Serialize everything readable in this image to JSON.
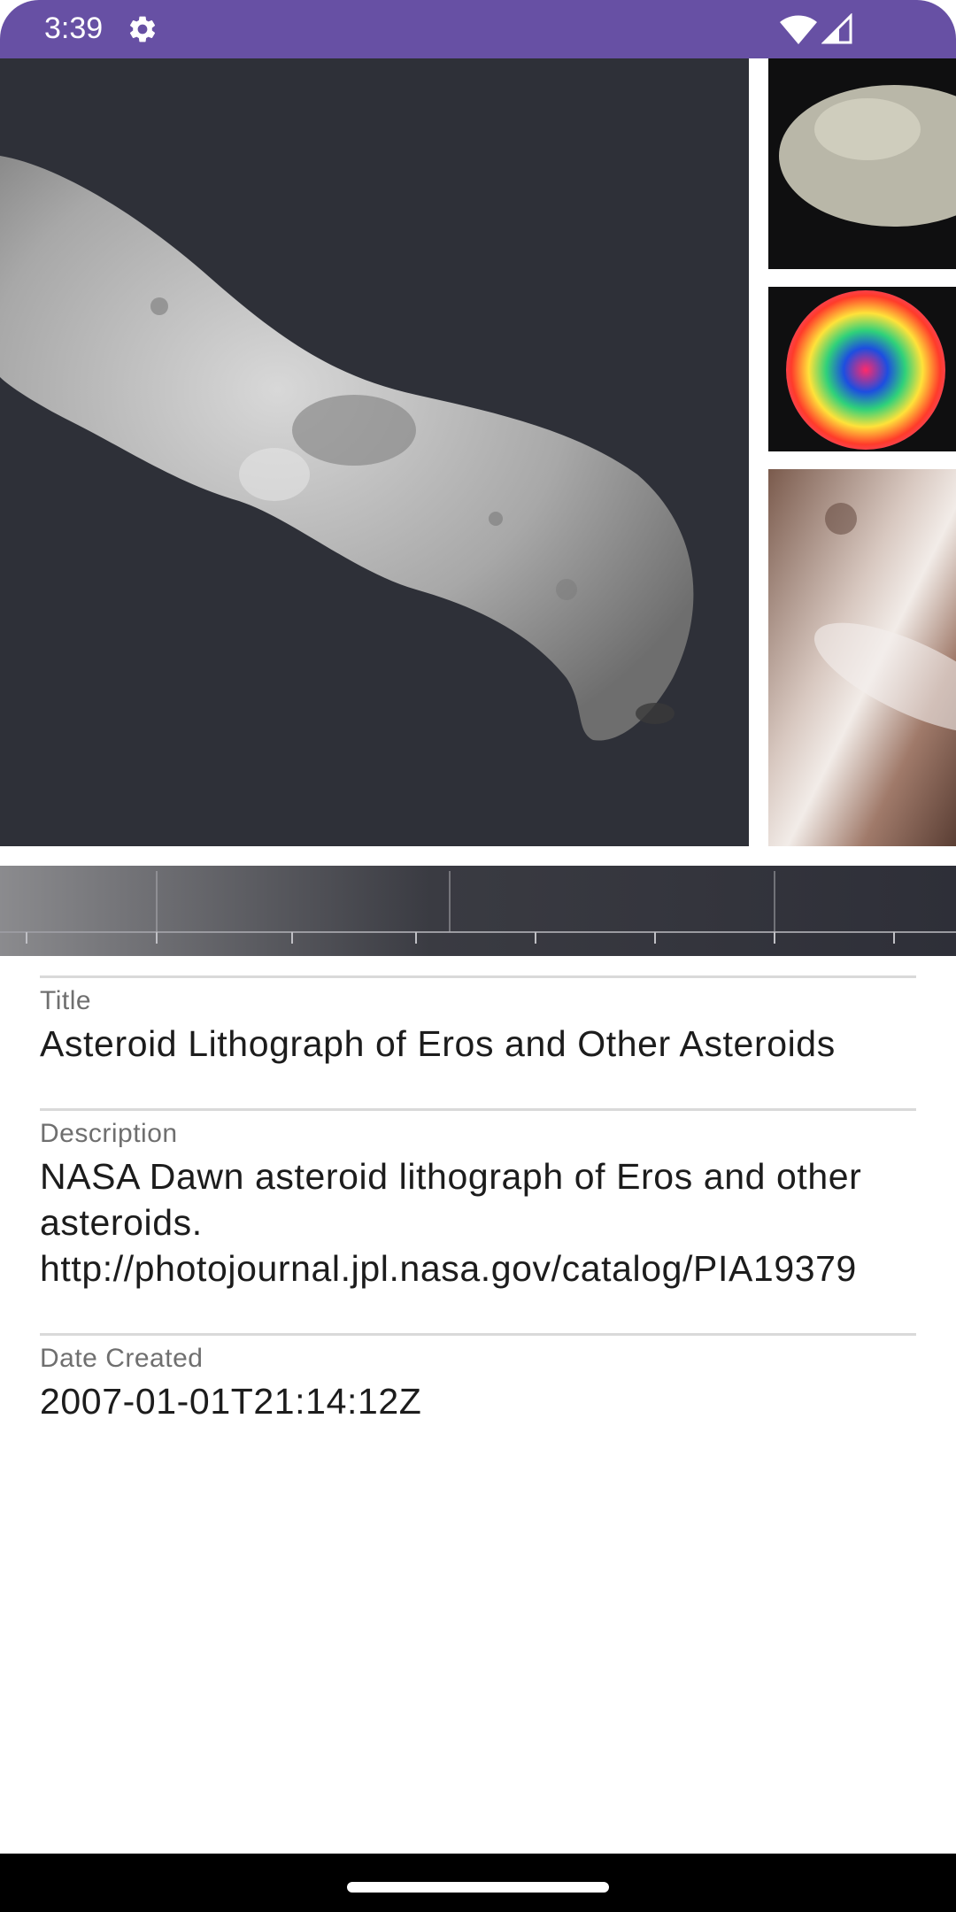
{
  "status_bar": {
    "time": "3:39",
    "background_color": "#6750a4",
    "icons": [
      "gear-icon",
      "wifi-icon",
      "cellular-signal-icon"
    ]
  },
  "hero_image": {
    "description_icon": "asteroid-lithograph-image"
  },
  "details": {
    "title_label": "Title",
    "title_value": "Asteroid Lithograph of Eros and Other Asteroids",
    "description_label": "Description",
    "description_value": "NASA Dawn asteroid lithograph of Eros and other asteroids. http://photojournal.jpl.nasa.gov/catalog/PIA19379",
    "date_label": "Date Created",
    "date_value": "2007-01-01T21:14:12Z"
  },
  "nav_bar": {
    "icons": [
      "home-handle-icon"
    ]
  }
}
